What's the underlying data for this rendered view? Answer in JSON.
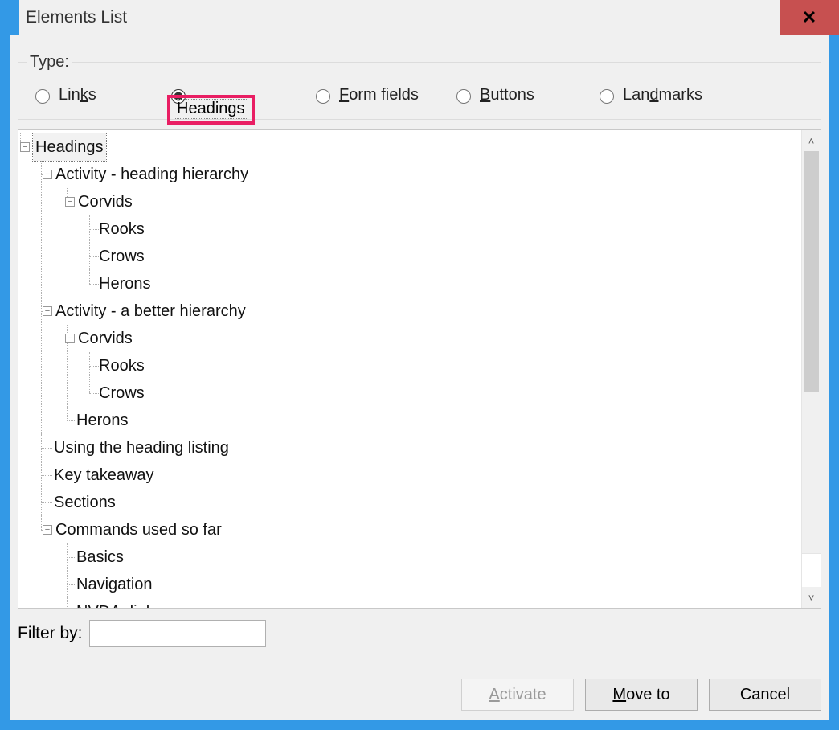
{
  "title": "Elements List",
  "type_group": {
    "legend": "Type:",
    "options": {
      "links": {
        "prefix": "Lin",
        "key": "k",
        "suffix": "s"
      },
      "headings": {
        "prefix": "",
        "key": "H",
        "suffix": "eadings"
      },
      "formfields": {
        "prefix": "",
        "key": "F",
        "suffix": "orm fields"
      },
      "buttons": {
        "prefix": "",
        "key": "B",
        "suffix": "uttons"
      },
      "landmarks": {
        "prefix": "Lan",
        "key": "d",
        "suffix": "marks"
      }
    },
    "selected": "headings"
  },
  "tree": {
    "root": "Headings",
    "n1": "Activity - heading hierarchy",
    "n1_1": "Corvids",
    "n1_1_1": "Rooks",
    "n1_1_2": "Crows",
    "n1_1_3": "Herons",
    "n2": "Activity - a better hierarchy",
    "n2_1": "Corvids",
    "n2_1_1": "Rooks",
    "n2_1_2": "Crows",
    "n2_2": "Herons",
    "n3": "Using the heading listing",
    "n4": "Key takeaway",
    "n5": "Sections",
    "n6": "Commands used so far",
    "n6_1": "Basics",
    "n6_2": "Navigation",
    "n6_3": "NVDA dialogs"
  },
  "filter": {
    "label": "Filter by:",
    "value": ""
  },
  "buttons": {
    "activate": {
      "prefix": "",
      "key": "A",
      "suffix": "ctivate"
    },
    "moveto": {
      "prefix": "",
      "key": "M",
      "suffix": "ove to"
    },
    "cancel": {
      "prefix": "Cancel",
      "key": "",
      "suffix": ""
    }
  },
  "highlight": {
    "color": "#e91e63",
    "target": "headings"
  }
}
